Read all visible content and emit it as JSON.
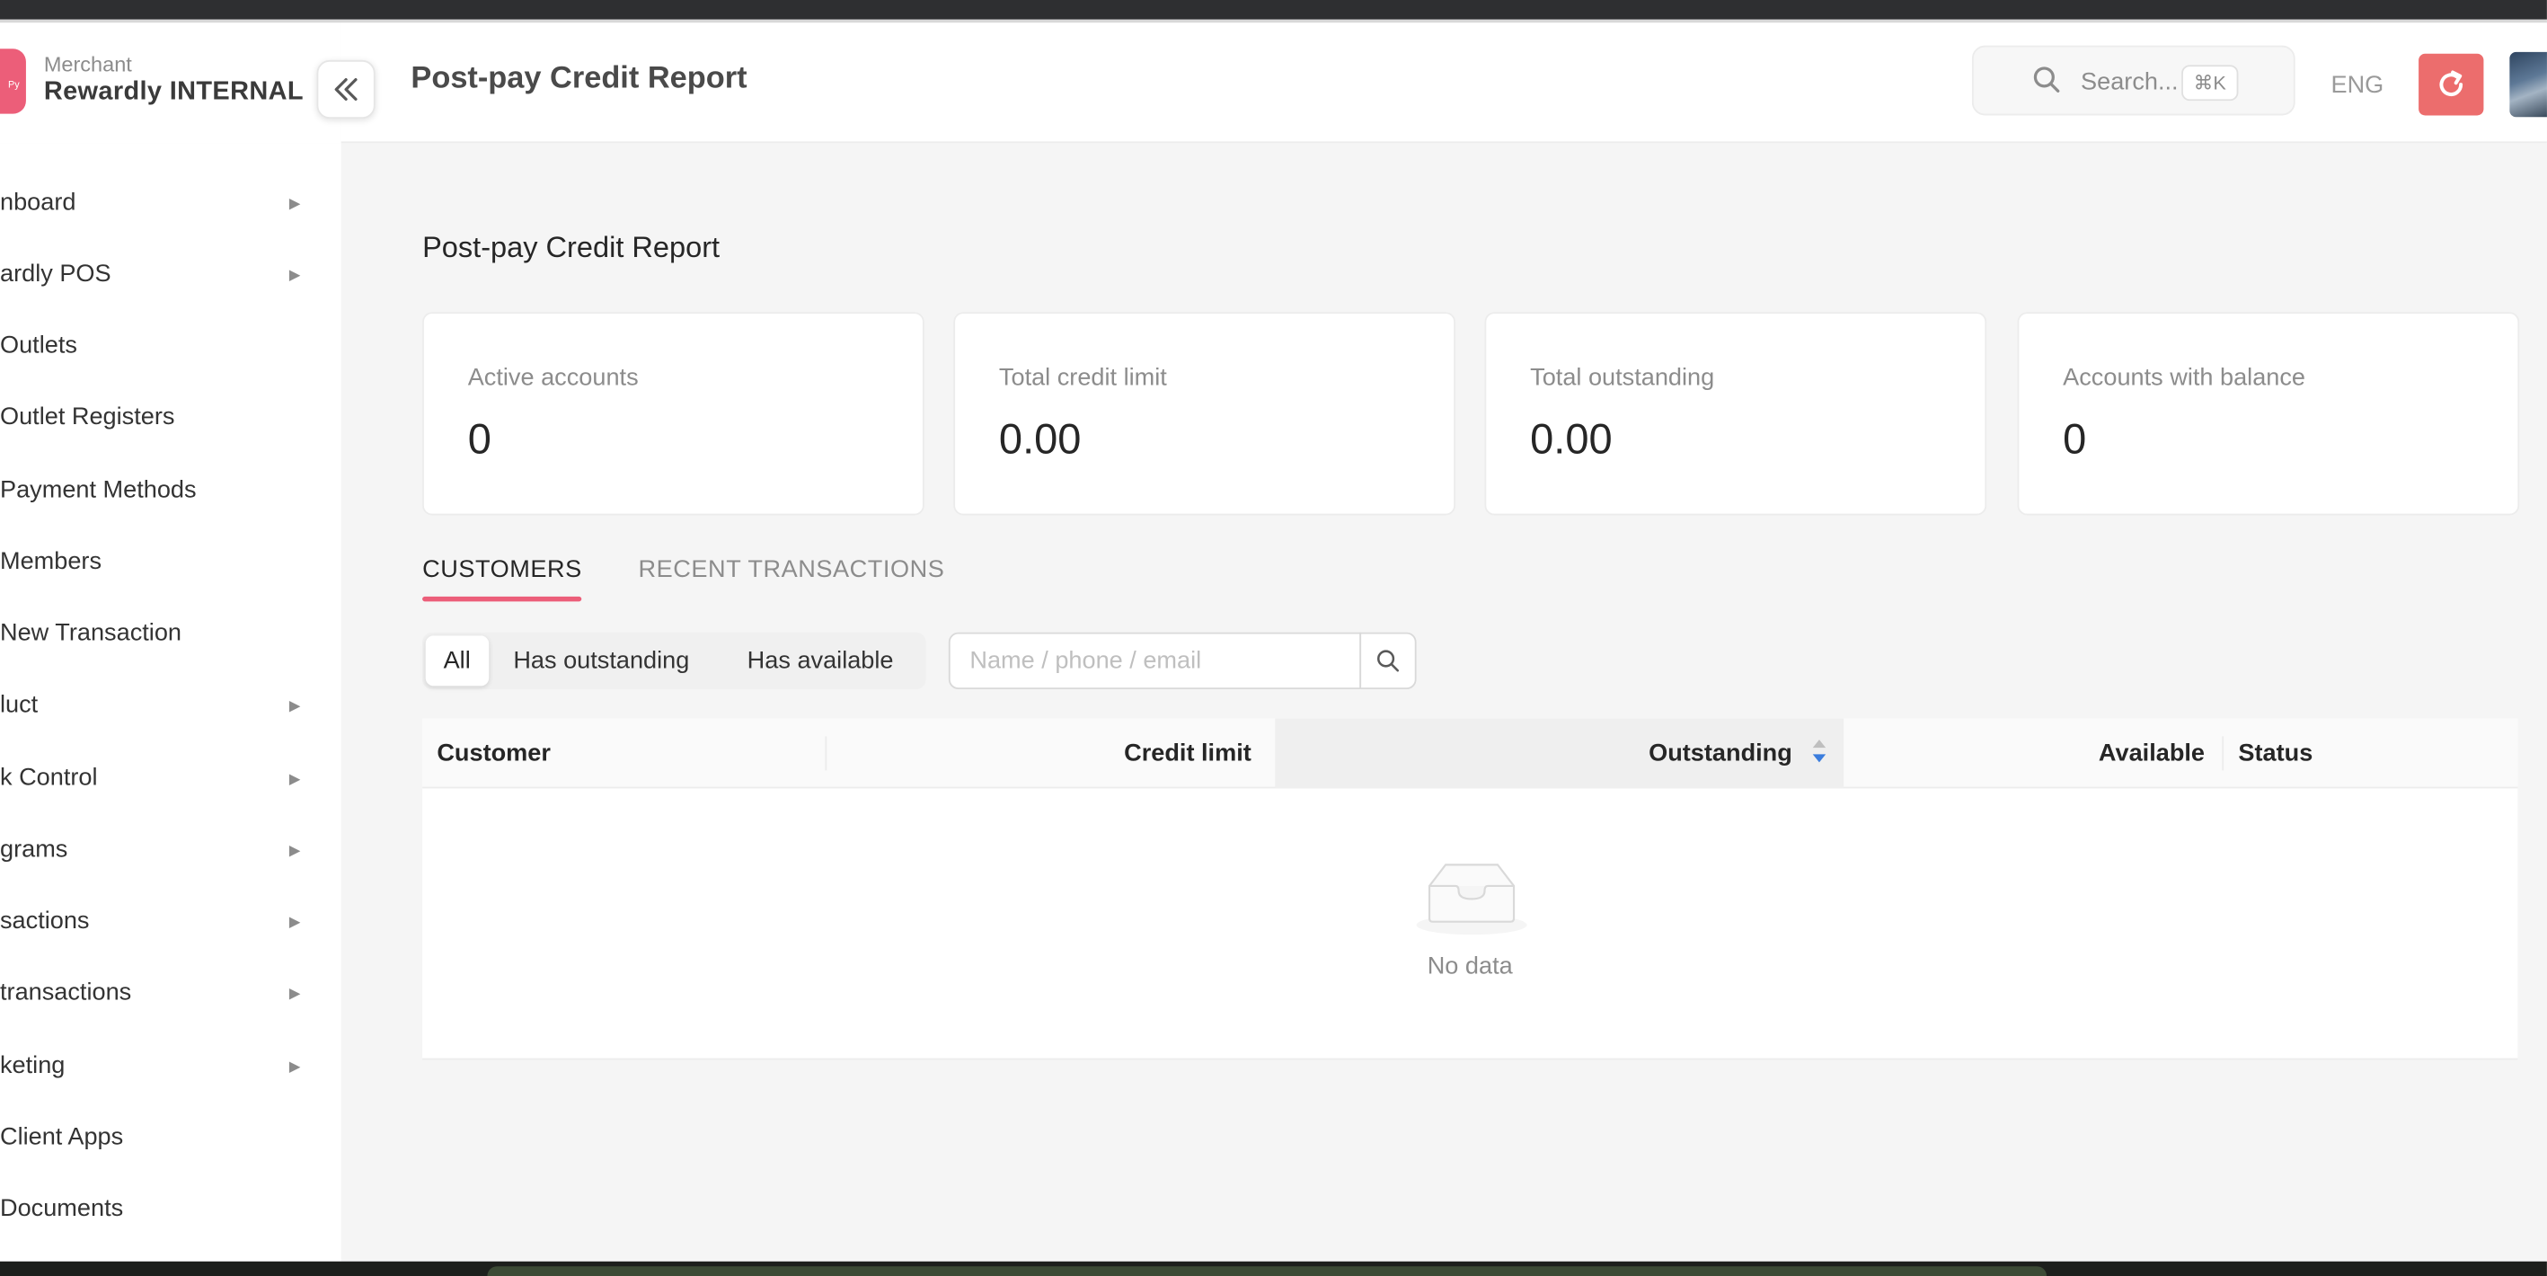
{
  "brand": {
    "subtitle": "Merchant",
    "name": "Rewardly INTERNAL",
    "logo_text": "Py"
  },
  "header": {
    "title": "Post-pay Credit Report",
    "search_placeholder": "Search...",
    "search_shortcut": "⌘K",
    "language": "ENG"
  },
  "sidebar": {
    "items": [
      {
        "label": "nboard",
        "has_submenu": true
      },
      {
        "label": "ardly POS",
        "has_submenu": true
      },
      {
        "label": "Outlets",
        "has_submenu": false
      },
      {
        "label": "Outlet Registers",
        "has_submenu": false
      },
      {
        "label": "Payment Methods",
        "has_submenu": false
      },
      {
        "label": "Members",
        "has_submenu": false
      },
      {
        "label": "New Transaction",
        "has_submenu": false
      },
      {
        "label": "luct",
        "has_submenu": true
      },
      {
        "label": "k Control",
        "has_submenu": true
      },
      {
        "label": "grams",
        "has_submenu": true
      },
      {
        "label": "sactions",
        "has_submenu": true
      },
      {
        "label": " transactions",
        "has_submenu": true
      },
      {
        "label": "keting",
        "has_submenu": true
      },
      {
        "label": "Client Apps",
        "has_submenu": false
      },
      {
        "label": "Documents",
        "has_submenu": false
      }
    ]
  },
  "main": {
    "title": "Post-pay Credit Report",
    "cards": [
      {
        "label": "Active accounts",
        "value": "0"
      },
      {
        "label": "Total credit limit",
        "value": "0.00"
      },
      {
        "label": "Total outstanding",
        "value": "0.00"
      },
      {
        "label": "Accounts with balance",
        "value": "0"
      }
    ],
    "tabs": [
      {
        "label": "CUSTOMERS",
        "active": true
      },
      {
        "label": "RECENT TRANSACTIONS",
        "active": false
      }
    ],
    "filter": {
      "options": [
        "All",
        "Has outstanding",
        "Has available"
      ],
      "selected": "All",
      "search_placeholder": "Name / phone / email",
      "search_value": ""
    },
    "table": {
      "columns": [
        "Customer",
        "Credit limit",
        "Outstanding",
        "Available",
        "Status"
      ],
      "sorted_column": "Outstanding",
      "rows": [],
      "empty_text": "No data"
    }
  },
  "colors": {
    "accent": "#ec5e79",
    "refresh_button": "#ec6d6d",
    "sort_active": "#3b7ddd"
  }
}
